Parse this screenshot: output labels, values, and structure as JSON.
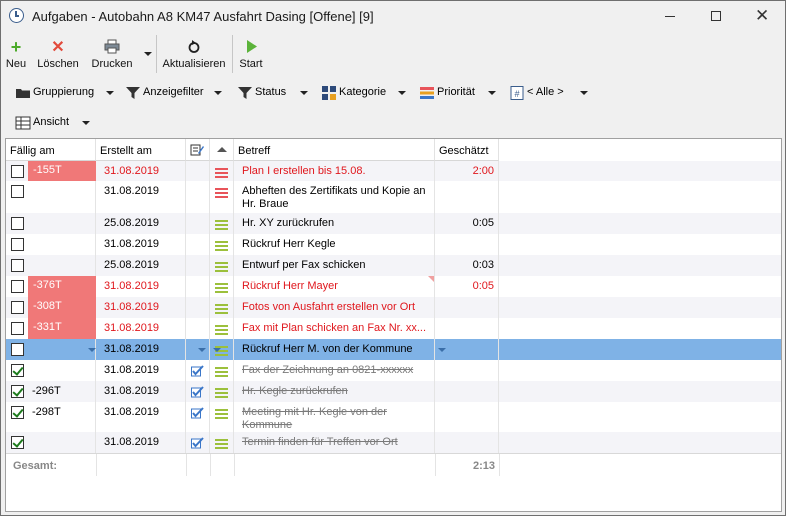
{
  "window": {
    "title": "Aufgaben - Autobahn A8 KM47 Ausfahrt Dasing [Offene] [9]"
  },
  "toolbar": {
    "new_label": "Neu",
    "delete_label": "Löschen",
    "print_label": "Drucken",
    "refresh_label": "Aktualisieren",
    "start_label": "Start"
  },
  "filterbar": {
    "grouping_label": "Gruppierung",
    "displayfilter_label": "Anzeigefilter",
    "status_label": "Status",
    "category_label": "Kategorie",
    "priority_label": "Priorität",
    "all_label": "< Alle >",
    "view_label": "Ansicht"
  },
  "columns": {
    "due": "Fällig am",
    "created": "Erstellt am",
    "subject": "Betreff",
    "estimated": "Geschätzt"
  },
  "colors": {
    "overdue_bg": "#f07878",
    "red_text": "#e0171d",
    "selected_bg": "#7fb2e6",
    "prio_high": "#e8545a",
    "prio_normal": "#9cc03c"
  },
  "rows": [
    {
      "done": false,
      "due": "-155T",
      "overdue": true,
      "created": "31.08.2019",
      "red": true,
      "edit": false,
      "prio": "high",
      "subject": "Plan I erstellen bis 15.08.",
      "estimated": "2:00",
      "strike": false,
      "note": false
    },
    {
      "done": false,
      "due": "",
      "overdue": false,
      "created": "31.08.2019",
      "red": false,
      "edit": false,
      "prio": "high",
      "subject": "Abheften des Zertifikats und Kopie an Hr. Braue",
      "estimated": "",
      "strike": false,
      "note": false
    },
    {
      "done": false,
      "due": "",
      "overdue": false,
      "created": "25.08.2019",
      "red": false,
      "edit": false,
      "prio": "normal",
      "subject": "Hr. XY zurückrufen",
      "estimated": "0:05",
      "strike": false,
      "note": false
    },
    {
      "done": false,
      "due": "",
      "overdue": false,
      "created": "31.08.2019",
      "red": false,
      "edit": false,
      "prio": "normal",
      "subject": "Rückruf Herr Kegle",
      "estimated": "",
      "strike": false,
      "note": false
    },
    {
      "done": false,
      "due": "",
      "overdue": false,
      "created": "25.08.2019",
      "red": false,
      "edit": false,
      "prio": "normal",
      "subject": "Entwurf per Fax schicken",
      "estimated": "0:03",
      "strike": false,
      "note": false
    },
    {
      "done": false,
      "due": "-376T",
      "overdue": true,
      "created": "31.08.2019",
      "red": true,
      "edit": false,
      "prio": "normal",
      "subject": "Rückruf Herr Mayer",
      "estimated": "0:05",
      "strike": false,
      "note": true
    },
    {
      "done": false,
      "due": "-308T",
      "overdue": true,
      "created": "31.08.2019",
      "red": true,
      "edit": false,
      "prio": "normal",
      "subject": "Fotos von Ausfahrt erstellen vor Ort",
      "estimated": "",
      "strike": false,
      "note": false
    },
    {
      "done": false,
      "due": "-331T",
      "overdue": true,
      "created": "31.08.2019",
      "red": true,
      "edit": false,
      "prio": "normal",
      "subject": "Fax mit Plan schicken an Fax Nr. xx...",
      "estimated": "",
      "strike": false,
      "note": false
    },
    {
      "done": false,
      "due": "",
      "overdue": false,
      "created": "31.08.2019",
      "red": false,
      "edit": false,
      "prio": "normal",
      "subject": "Rückruf Herr M. von der Kommune",
      "estimated": "",
      "strike": false,
      "note": false,
      "selected": true
    },
    {
      "done": true,
      "due": "",
      "overdue": false,
      "created": "31.08.2019",
      "red": false,
      "edit": true,
      "prio": "normal",
      "subject": "Fax der Zeichnung an 0821-xxxxxx",
      "estimated": "",
      "strike": true,
      "note": false
    },
    {
      "done": true,
      "due": "-296T",
      "overdue": false,
      "created": "31.08.2019",
      "red": false,
      "edit": true,
      "prio": "normal",
      "subject": "Hr. Kegle zurückrufen",
      "estimated": "",
      "strike": true,
      "note": false
    },
    {
      "done": true,
      "due": "-298T",
      "overdue": false,
      "created": "31.08.2019",
      "red": false,
      "edit": true,
      "prio": "normal",
      "subject": "Meeting mit Hr. Kegle von der Kommune",
      "estimated": "",
      "strike": true,
      "note": false
    },
    {
      "done": true,
      "due": "",
      "overdue": false,
      "created": "31.08.2019",
      "red": false,
      "edit": true,
      "prio": "normal",
      "subject": "Termin finden für Treffen vor Ort",
      "estimated": "",
      "strike": true,
      "note": false
    }
  ],
  "footer": {
    "total_label": "Gesamt:",
    "total_value": "2:13"
  }
}
